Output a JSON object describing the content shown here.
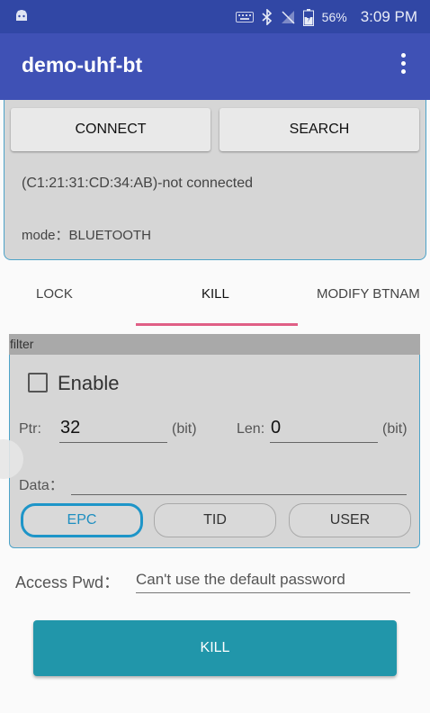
{
  "status_bar": {
    "battery": "56%",
    "time": "3:09 PM",
    "icons": [
      "android-icon",
      "keyboard-icon",
      "bluetooth-icon",
      "no-signal-icon",
      "battery-icon"
    ]
  },
  "app_bar": {
    "title": "demo-uhf-bt",
    "overflow_icon": "more-vert-icon"
  },
  "connection": {
    "connect_label": "CONNECT",
    "search_label": "SEARCH",
    "status": "(C1:21:31:CD:34:AB)-not connected",
    "mode": "mode：BLUETOOTH"
  },
  "tabs": [
    {
      "label": "LOCK"
    },
    {
      "label": "KILL"
    },
    {
      "label": "MODIFY BTNAM"
    }
  ],
  "filter": {
    "header": "filter",
    "enable_label": "Enable",
    "enable_checked": false,
    "ptr_label": "Ptr:",
    "ptr_value": "32",
    "bit_unit": "(bit)",
    "len_label": "Len:",
    "len_value": "0",
    "data_label": "Data：",
    "data_value": "",
    "banks": [
      {
        "label": "EPC",
        "selected": true
      },
      {
        "label": "TID",
        "selected": false
      },
      {
        "label": "USER",
        "selected": false
      }
    ]
  },
  "access": {
    "label": "Access Pwd：",
    "placeholder": "Can't use the default password"
  },
  "kill_button": "KILL",
  "colors": {
    "status_bar": "#3147a5",
    "app_bar": "#3f51b5",
    "tab_indicator": "#e05f86",
    "accent": "#1e95c8",
    "kill_button": "#2196aa"
  }
}
